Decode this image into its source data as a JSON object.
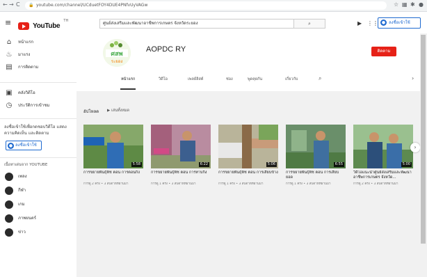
{
  "browser": {
    "url": "youtube.com/channel/UCduetFOY4DUE4PNfvUyVAGw",
    "back": "←",
    "forward": "→",
    "reload": "C"
  },
  "header": {
    "logo_text": "YouTube",
    "logo_sup": "TH",
    "search_value": "ศูนย์ส่งเสริมและพัฒนาอาชีพการเกษตร จังหวัดระยอง",
    "search_icon": "search-icon",
    "signin_label": "ลงชื่อเข้าใช้"
  },
  "sidebar": {
    "items": [
      {
        "label": "หน้าแรก",
        "icon": "home-icon"
      },
      {
        "label": "มาแรง",
        "icon": "fire-icon"
      },
      {
        "label": "การติดตาม",
        "icon": "subscriptions-icon"
      },
      {
        "label": "คลังวิดีโอ",
        "icon": "library-icon"
      },
      {
        "label": "ประวัติการเข้าชม",
        "icon": "history-icon"
      }
    ],
    "signin_prompt": "ลงชื่อเข้าใช้เพื่อกดชอบวิดีโอ แสดงความคิดเห็น และติดตาม",
    "signin_label": "ลงชื่อเข้าใช้",
    "best_title": "เนื้อหาเด่นจาก YOUTUBE",
    "categories": [
      "เพลง",
      "กีฬา",
      "เกม",
      "ภาพยนตร์",
      "ข่าว"
    ]
  },
  "channel": {
    "name": "AOPDC RY",
    "logo_text": "ศสพ ระยอง",
    "subscribe_label": "ติดตาม",
    "tabs": [
      "หน้าแรก",
      "วิดีโอ",
      "เพลย์ลิสต์",
      "ช่อง",
      "พูดคุยกัน",
      "เกี่ยวกับ"
    ]
  },
  "section": {
    "title": "อัปโหลด",
    "play_all": "เล่นทั้งหมด"
  },
  "videos": [
    {
      "title": "การขยายพันธุ์พืช ตอน การตอนกิ่ง",
      "meta": "การดู 2 ครั้ง • 3 สัปดาห์ที่ผ่านมา",
      "duration": "5:58",
      "bg": "#7aa55a"
    },
    {
      "title": "การขยายพันธุ์พืช ตอน การทาบกิ่ง",
      "meta": "การดู 1 ครั้ง • 3 สัปดาห์ที่ผ่านมา",
      "duration": "6:22",
      "bg": "#a96f84"
    },
    {
      "title": "การขยายพันธุ์พืช ตอน การเสียบข้าง",
      "meta": "การดู 1 ครั้ง • 3 สัปดาห์ที่ผ่านมา",
      "duration": "5:06",
      "bg": "#8d9a6a"
    },
    {
      "title": "การขยายพันธุ์พืช ตอน การเสียบยอด",
      "meta": "การดู 1 ครั้ง • 3 สัปดาห์ที่ผ่านมา",
      "duration": "6:55",
      "bg": "#6a8f6a"
    },
    {
      "title": "วิดีโอแนะนำศูนย์ส่งเสริมและพัฒนาอาชีพการเกษตร จังหวัด...",
      "meta": "การดู 2 ครั้ง • 3 สัปดาห์ที่ผ่านมา",
      "duration": "5:00",
      "bg": "#7fae7d"
    }
  ]
}
